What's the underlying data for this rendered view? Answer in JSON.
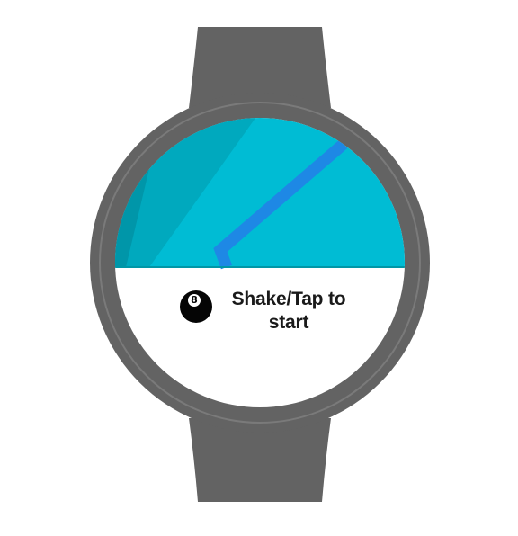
{
  "app": {
    "prompt": "Shake/Tap to start",
    "ball_number": "8"
  },
  "icons": {
    "ball": "magic-8-ball-icon"
  },
  "colors": {
    "strap": "#636363",
    "bezel": "#636363",
    "screen_top": "#00bcd4",
    "screen_bottom": "#ffffff",
    "accent_line": "#1e88e5",
    "text": "#1a1a1a"
  }
}
